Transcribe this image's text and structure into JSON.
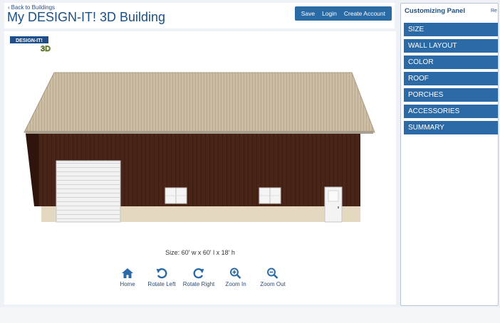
{
  "header": {
    "back_label": "Back to Buildings",
    "title": "My DESIGN-IT! 3D Building",
    "actions": [
      "Save",
      "Login",
      "Create Account"
    ]
  },
  "logo": {
    "line1": "DESIGN-IT!",
    "line2": "3D"
  },
  "viewer": {
    "size_text": "Size: 60' w x 60' l x 18' h",
    "controls": [
      {
        "icon": "home-icon",
        "label": "Home"
      },
      {
        "icon": "rotate-left-icon",
        "label": "Rotate Left"
      },
      {
        "icon": "rotate-right-icon",
        "label": "Rotate Right"
      },
      {
        "icon": "zoom-in-icon",
        "label": "Zoom In"
      },
      {
        "icon": "zoom-out-icon",
        "label": "Zoom Out"
      }
    ]
  },
  "panel": {
    "title": "Customizing Panel",
    "reset": "Re",
    "items": [
      "SIZE",
      "WALL LAYOUT",
      "COLOR",
      "ROOF",
      "PORCHES",
      "ACCESSORIES",
      "SUMMARY"
    ]
  },
  "colors": {
    "accent": "#2c6aa7",
    "roof": "#cbbda6",
    "wall": "#4a2417",
    "wainscot": "#e5d8c1",
    "door": "#f0f0f0"
  }
}
